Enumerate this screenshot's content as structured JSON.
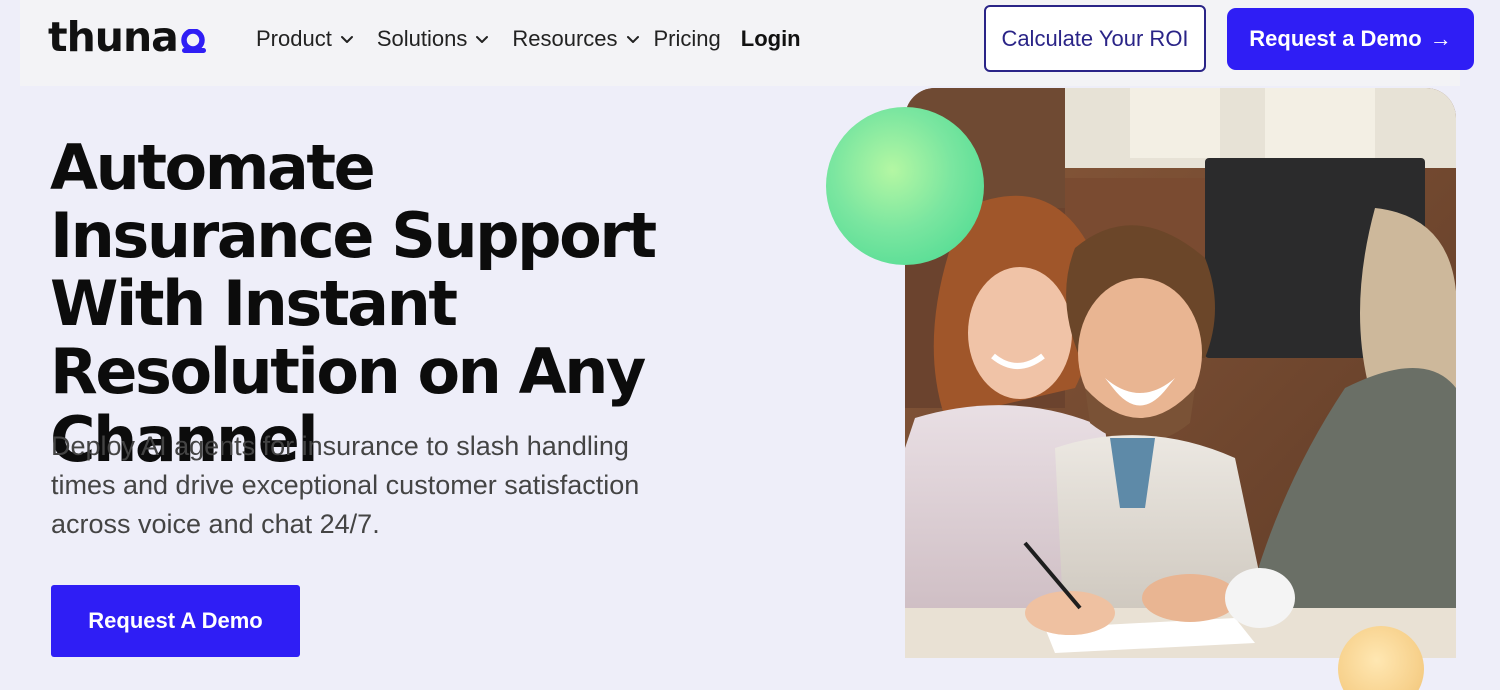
{
  "brand": {
    "logo_text": "thuna",
    "accent_color": "#2f1ef5",
    "outline_color": "#2a2487"
  },
  "nav": {
    "items": [
      {
        "label": "Product",
        "has_dropdown": true
      },
      {
        "label": "Solutions",
        "has_dropdown": true
      },
      {
        "label": "Resources",
        "has_dropdown": true
      },
      {
        "label": "Pricing",
        "has_dropdown": false
      }
    ],
    "login_label": "Login",
    "roi_label": "Calculate Your ROI",
    "demo_label": "Request a Demo",
    "demo_icon": "arrow-right-icon"
  },
  "hero": {
    "title": "Automate Insurance Support With Instant Resolution on Any Channel",
    "subtitle": "Deploy AI agents for insurance to slash handling times and drive exceptional customer satisfaction across voice and chat 24/7.",
    "cta_label": "Request A Demo"
  },
  "image": {
    "description_icon": "hero-photo"
  }
}
